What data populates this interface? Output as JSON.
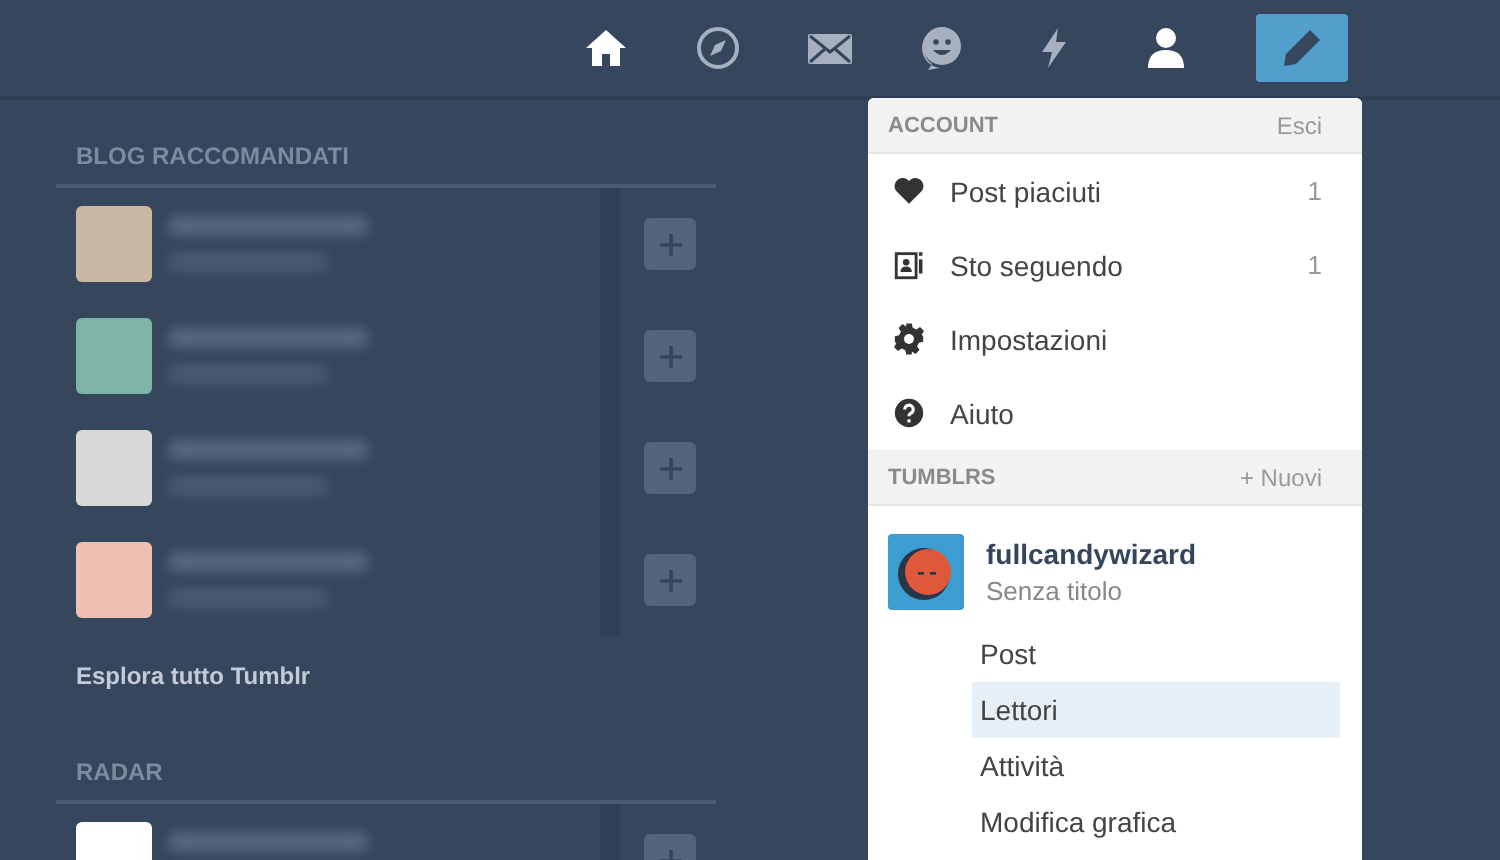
{
  "nav": [
    {
      "kind": "home",
      "active": true
    },
    {
      "kind": "compass",
      "active": false
    },
    {
      "kind": "mail",
      "active": false
    },
    {
      "kind": "face",
      "active": false
    },
    {
      "kind": "bolt",
      "active": false
    },
    {
      "kind": "person",
      "active": true
    },
    {
      "kind": "compose",
      "active": false
    }
  ],
  "sidebar": {
    "recommended": {
      "title": "BLOG RACCOMANDATI",
      "blogs": [
        {
          "color": "#c9b7a4"
        },
        {
          "color": "#7fb5a6"
        },
        {
          "color": "#d8d8d8"
        },
        {
          "color": "#efc0b4"
        }
      ],
      "link": "Esplora tutto Tumblr"
    },
    "radar": {
      "title": "RADAR",
      "blogs": [
        {
          "color": "#ffffff"
        }
      ]
    }
  },
  "menu": {
    "account": {
      "title": "ACCOUNT",
      "action": "Esci",
      "items": [
        {
          "kind": "heart",
          "label": "Post piaciuti",
          "count": "1"
        },
        {
          "kind": "following",
          "label": "Sto seguendo",
          "count": "1"
        },
        {
          "kind": "gear",
          "label": "Impostazioni"
        },
        {
          "kind": "help",
          "label": "Aiuto"
        }
      ]
    },
    "tumblrs": {
      "title": "TUMBLRS",
      "action": "+ Nuovi",
      "blog": {
        "name": "fullcandywizard",
        "title": "Senza titolo"
      },
      "items": [
        {
          "label": "Post",
          "selected": false
        },
        {
          "label": "Lettori",
          "selected": true
        },
        {
          "label": "Attività",
          "selected": false
        },
        {
          "label": "Modifica grafica",
          "selected": false
        }
      ]
    }
  }
}
